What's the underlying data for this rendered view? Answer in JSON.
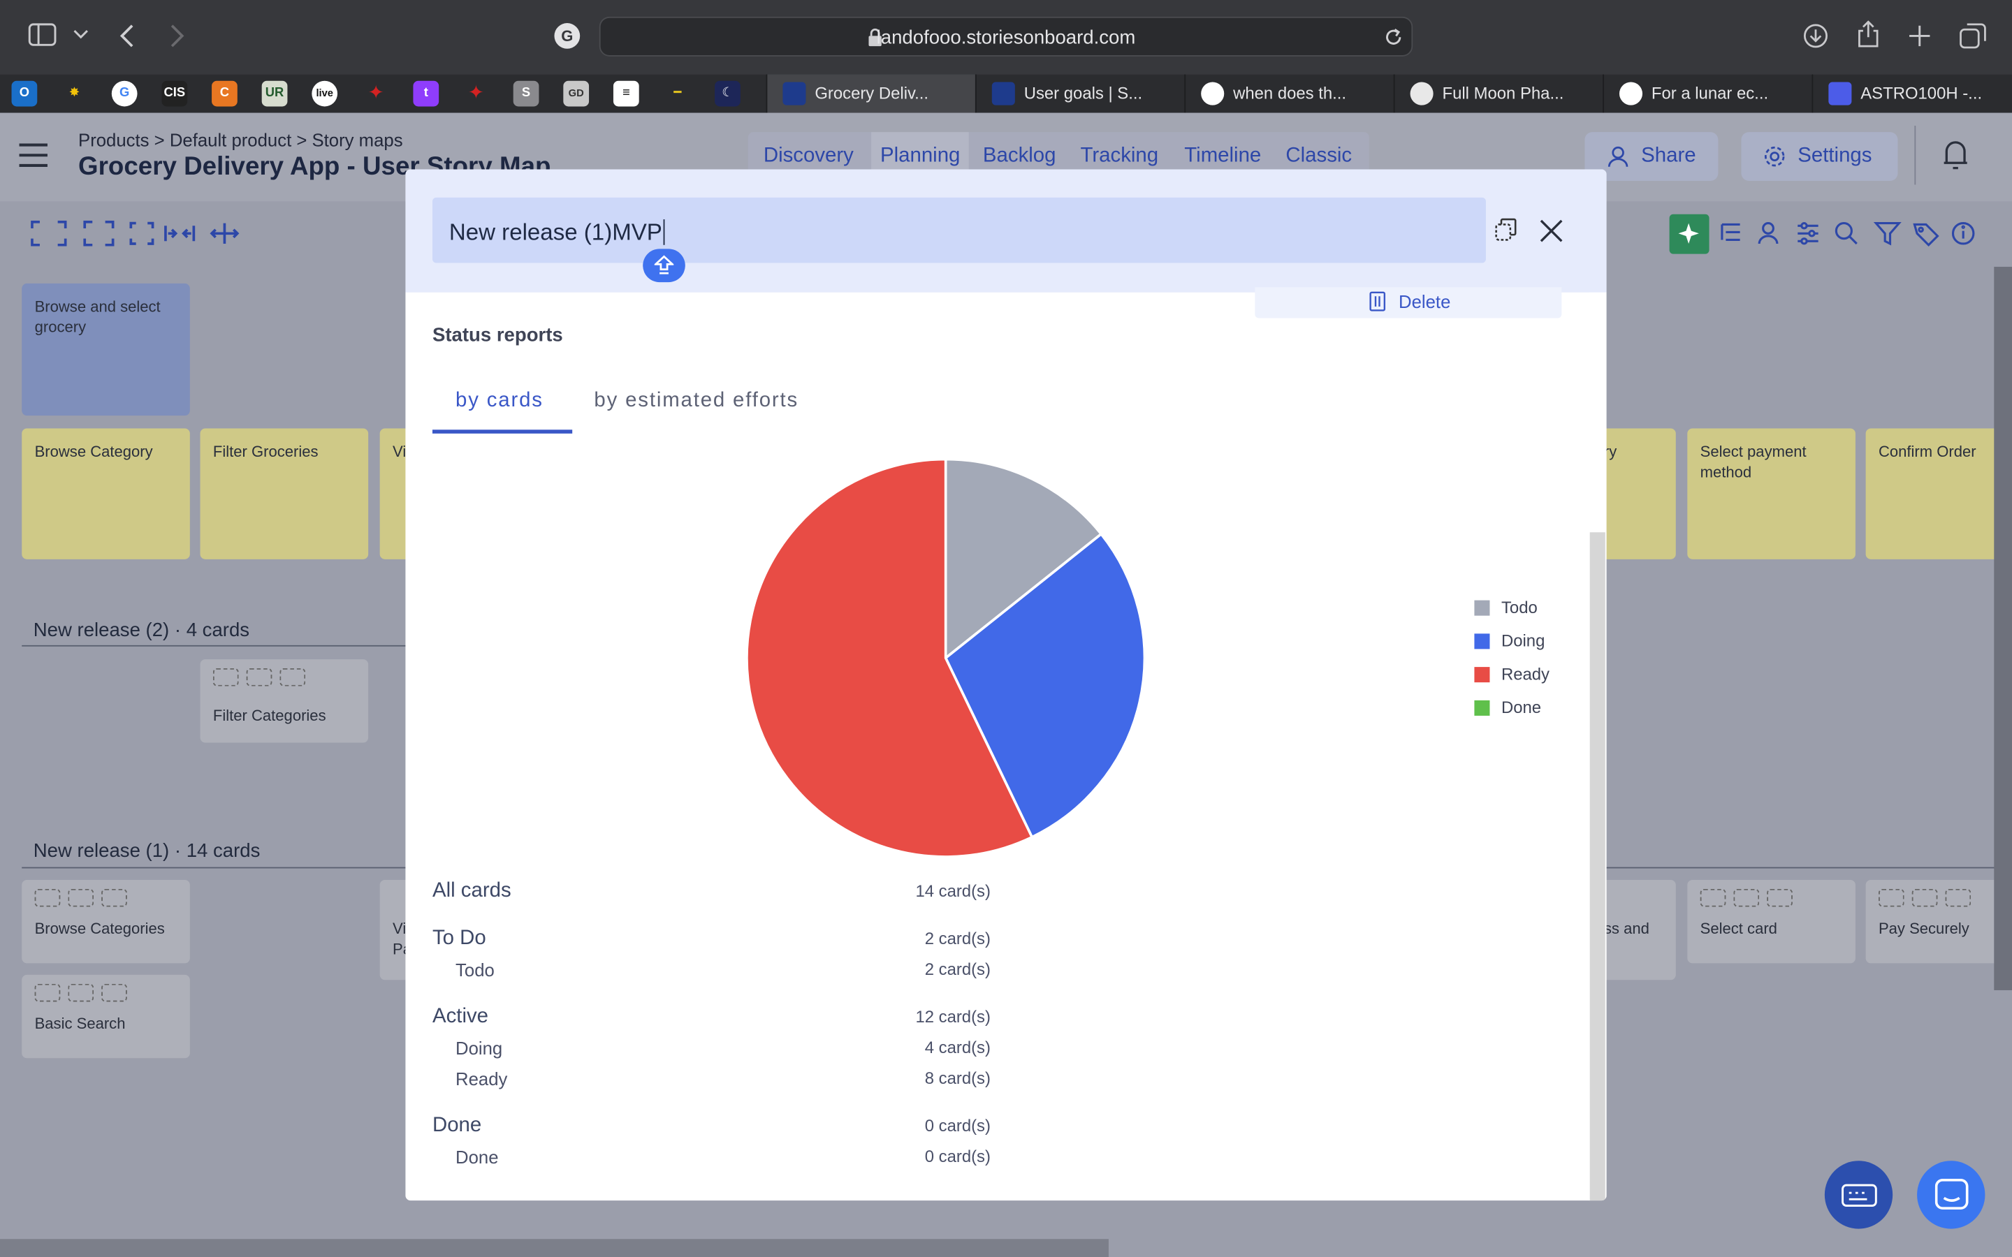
{
  "browser": {
    "url": "landofooo.storiesonboard.com",
    "tabs": [
      {
        "label": "Grocery Deliv...",
        "active": true
      },
      {
        "label": "User goals | S..."
      },
      {
        "label": "when does th..."
      },
      {
        "label": "Full Moon Pha..."
      },
      {
        "label": "For a lunar ec..."
      },
      {
        "label": "ASTRO100H -..."
      }
    ],
    "bookmark_icons": [
      "outlook",
      "star",
      "google",
      "cis",
      "c",
      "ur",
      "live",
      "maple",
      "twitch",
      "maple2",
      "s",
      "gd",
      "stripes",
      "pencil",
      "moon"
    ]
  },
  "app": {
    "breadcrumb": "Products > Default product > Story maps",
    "title": "Grocery Delivery App - User Story Map",
    "nav": [
      "Discovery",
      "Planning",
      "Backlog",
      "Tracking",
      "Timeline",
      "Classic"
    ],
    "share_label": "Share",
    "settings_label": "Settings",
    "activity": "Browse and select grocery",
    "steps": [
      "Browse Category",
      "Filter Groceries",
      "Vi",
      "ry",
      "Select payment method",
      "Confirm Order"
    ],
    "release2": {
      "heading": "New release (2) · 4 cards",
      "card": "Filter Categories"
    },
    "release1": {
      "heading": "New release (1) · 14 cards",
      "cards": [
        "Browse Categories",
        "Basic Search",
        "Vi Pa",
        "ss and",
        "Select card",
        "Pay Securely"
      ]
    }
  },
  "modal": {
    "title": "New release (1)MVP",
    "delete_label": "Delete",
    "section": "Status reports",
    "tabs": [
      "by cards",
      "by estimated efforts"
    ],
    "legend": [
      {
        "label": "Todo",
        "color": "#a3a9b7"
      },
      {
        "label": "Doing",
        "color": "#4169e8"
      },
      {
        "label": "Ready",
        "color": "#e84c45"
      },
      {
        "label": "Done",
        "color": "#5fc04b"
      }
    ],
    "stats": [
      {
        "label": "All cards",
        "count": "14 card(s)",
        "level": 1
      },
      {
        "label": "To Do",
        "count": "2 card(s)",
        "level": 1
      },
      {
        "label": "Todo",
        "count": "2 card(s)",
        "level": 2
      },
      {
        "label": "Active",
        "count": "12 card(s)",
        "level": 1
      },
      {
        "label": "Doing",
        "count": "4 card(s)",
        "level": 2
      },
      {
        "label": "Ready",
        "count": "8 card(s)",
        "level": 2
      },
      {
        "label": "Done",
        "count": "0 card(s)",
        "level": 1
      },
      {
        "label": "Done",
        "count": "0 card(s)",
        "level": 2
      }
    ]
  },
  "chart_data": {
    "type": "pie",
    "categories": [
      "Todo",
      "Doing",
      "Ready",
      "Done"
    ],
    "values": [
      2,
      4,
      8,
      0
    ],
    "colors": [
      "#a3a9b7",
      "#4169e8",
      "#e84c45",
      "#5fc04b"
    ],
    "legend": "right"
  }
}
